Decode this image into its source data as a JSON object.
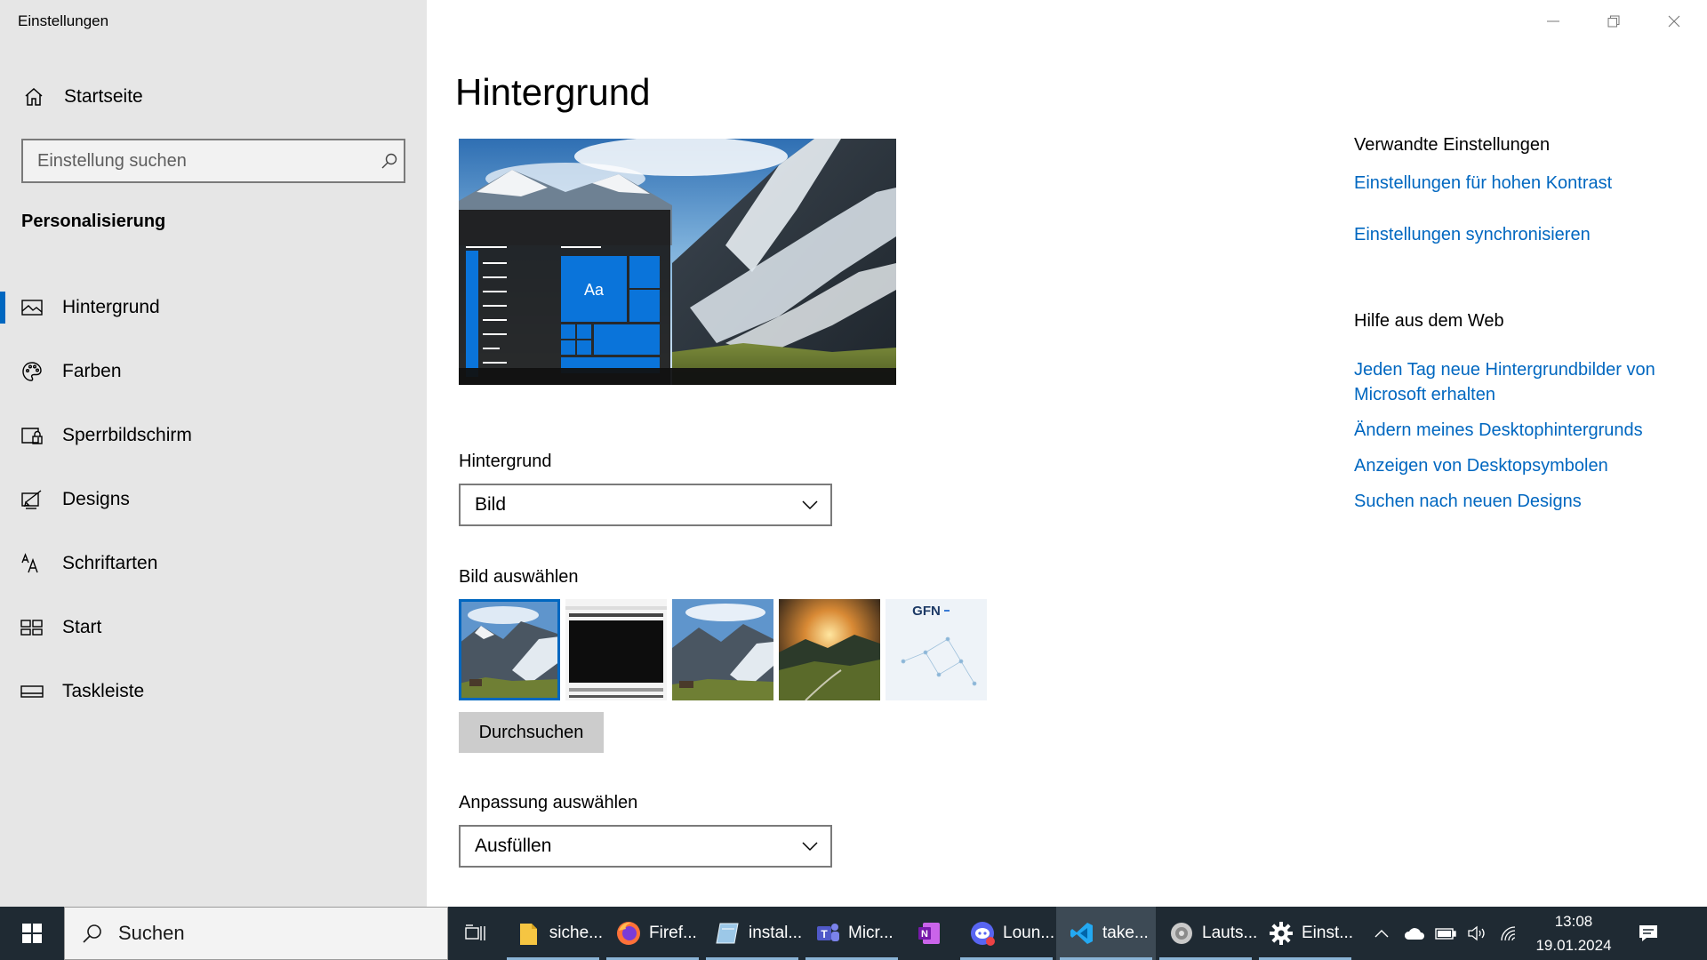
{
  "window": {
    "title": "Einstellungen"
  },
  "sidebar": {
    "home_label": "Startseite",
    "search_placeholder": "Einstellung suchen",
    "section_title": "Personalisierung",
    "items": [
      {
        "label": "Hintergrund",
        "icon": "picture-icon",
        "active": true
      },
      {
        "label": "Farben",
        "icon": "palette-icon",
        "active": false
      },
      {
        "label": "Sperrbildschirm",
        "icon": "lock-screen-icon",
        "active": false
      },
      {
        "label": "Designs",
        "icon": "themes-icon",
        "active": false
      },
      {
        "label": "Schriftarten",
        "icon": "fonts-icon",
        "active": false
      },
      {
        "label": "Start",
        "icon": "start-icon",
        "active": false
      },
      {
        "label": "Taskleiste",
        "icon": "taskbar-icon",
        "active": false
      }
    ]
  },
  "main": {
    "title": "Hintergrund",
    "preview_tile_text": "Aa",
    "background_label": "Hintergrund",
    "background_value": "Bild",
    "choose_picture_label": "Bild auswählen",
    "browse_label": "Durchsuchen",
    "fit_label": "Anpassung auswählen",
    "fit_value": "Ausfüllen",
    "thumb_logo_text": "GFN"
  },
  "related": {
    "heading": "Verwandte Einstellungen",
    "links": [
      "Einstellungen für hohen Kontrast",
      "Einstellungen synchronisieren"
    ]
  },
  "help": {
    "heading": "Hilfe aus dem Web",
    "links": [
      "Jeden Tag neue Hintergrundbilder von Microsoft erhalten",
      "Ändern meines Desktophintergrunds",
      "Anzeigen von Desktopsymbolen",
      "Suchen nach neuen Designs"
    ]
  },
  "taskbar": {
    "search_label": "Suchen",
    "apps": [
      {
        "label": "siche...",
        "icon": "folder-icon"
      },
      {
        "label": "Firef...",
        "icon": "firefox-icon"
      },
      {
        "label": "instal...",
        "icon": "installer-icon"
      },
      {
        "label": "Micr...",
        "icon": "teams-icon"
      },
      {
        "label": "",
        "icon": "onenote-icon"
      },
      {
        "label": "Loun...",
        "icon": "discord-icon"
      },
      {
        "label": "take...",
        "icon": "vscode-icon"
      },
      {
        "label": "Lauts...",
        "icon": "speaker-app-icon"
      },
      {
        "label": "Einst...",
        "icon": "settings-gear-icon"
      }
    ],
    "time": "13:08",
    "date": "19.01.2024"
  },
  "colors": {
    "accent": "#0067c0",
    "sidebar_bg": "#e6e6e6",
    "taskbar_bg": "#1f2a33"
  }
}
